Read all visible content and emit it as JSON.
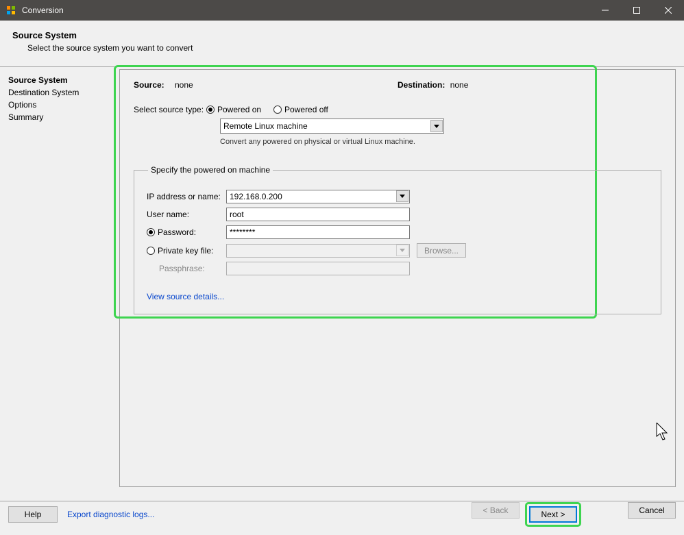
{
  "window": {
    "title": "Conversion"
  },
  "header": {
    "title": "Source System",
    "subtitle": "Select the source system you want to convert"
  },
  "sidebar": {
    "items": [
      {
        "label": "Source System",
        "selected": true
      },
      {
        "label": "Destination System",
        "selected": false
      },
      {
        "label": "Options",
        "selected": false
      },
      {
        "label": "Summary",
        "selected": false
      }
    ]
  },
  "main": {
    "source_label": "Source:",
    "source_value": "none",
    "dest_label": "Destination:",
    "dest_value": "none",
    "src_type_label": "Select source type:",
    "radio_on": "Powered on",
    "radio_off": "Powered off",
    "select_value": "Remote Linux machine",
    "select_help": "Convert any powered on physical or virtual Linux machine.",
    "group_legend": "Specify the powered on machine",
    "ip_label": "IP address or name:",
    "ip_value": "192.168.0.200",
    "user_label": "User name:",
    "user_value": "root",
    "password_label": "Password:",
    "password_value": "********",
    "pkey_label": "Private key file:",
    "pkey_value": "",
    "browse": "Browse...",
    "passphrase_label": "Passphrase:",
    "passphrase_value": "",
    "view_details": "View source details..."
  },
  "footer": {
    "help": "Help",
    "export": "Export diagnostic logs...",
    "back": "< Back",
    "next": "Next >",
    "cancel": "Cancel"
  }
}
